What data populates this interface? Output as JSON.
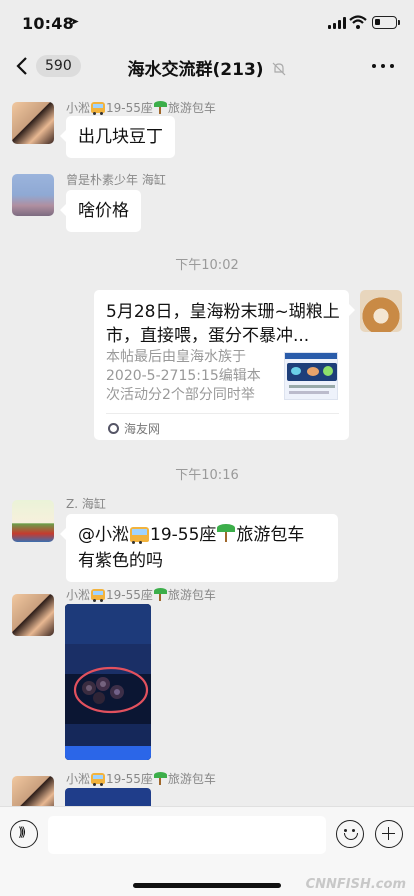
{
  "status_bar": {
    "time": "10:48",
    "battery_level": 0.25
  },
  "header": {
    "back_count": "590",
    "title": "海水交流群(213)"
  },
  "messages": [
    {
      "sender": "小淞",
      "sender_suffix": "19-55座",
      "sender_tail": "旅游包车",
      "text": "出几块豆丁"
    },
    {
      "sender": "曾是朴素少年 海缸",
      "text": "啥价格"
    },
    {
      "time_divider": "下午10:02"
    },
    {
      "link": {
        "title": "5月28日，皇海粉末珊~瑚粮上市，直接喂，蛋分不暴冲...",
        "description": "本帖最后由皇海水族于2020-5-2715:15编辑本次活动分2个部分同时举行...",
        "source": "海友网"
      }
    },
    {
      "time_divider": "下午10:16"
    },
    {
      "sender": "Z. 海缸",
      "text_part1": "@小淞",
      "text_part2": "19-55座",
      "text_part3": "旅游包车 有紫色的吗"
    },
    {
      "sender": "小淞",
      "sender_suffix": "19-55座",
      "sender_tail": "旅游包车",
      "image": "coral-photo"
    },
    {
      "sender": "小淞",
      "sender_suffix": "19-55座",
      "sender_tail": "旅游包车",
      "image": "coral-photo-partial"
    }
  ],
  "icons": {
    "back": "chevron-left-icon",
    "mute": "bell-off-icon",
    "more": "ellipsis-icon",
    "voice": "voice-icon",
    "emoji": "smiley-icon",
    "plus": "plus-icon"
  },
  "colors": {
    "background": "#ededed",
    "bubble": "#ffffff",
    "meta_text": "#888888"
  },
  "watermark": "CNNFISH.com"
}
